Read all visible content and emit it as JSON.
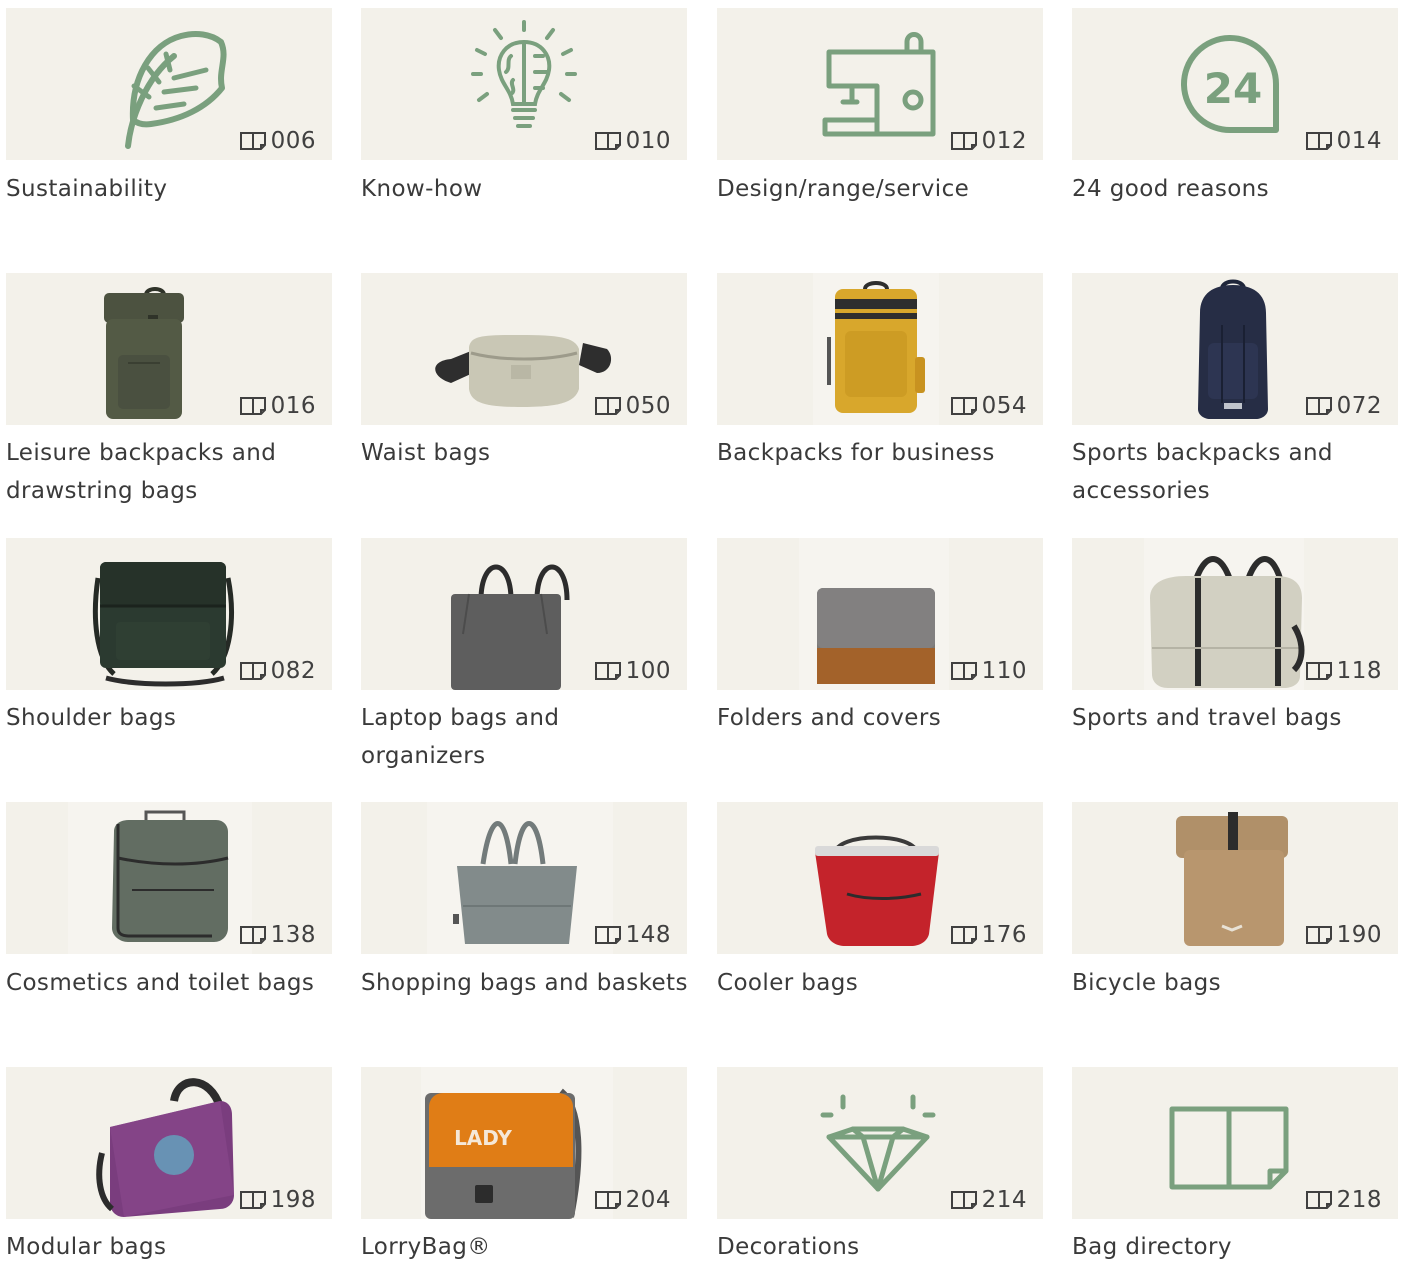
{
  "accent_color": "#7aa07e",
  "tile_color": "#f3f1ea",
  "categories": [
    {
      "label": "Sustainability",
      "page": "006",
      "icon": "leaf-icon"
    },
    {
      "label": "Know-how",
      "page": "010",
      "icon": "lightbulb-brain-icon"
    },
    {
      "label": "Design/range/service",
      "page": "012",
      "icon": "sewing-machine-icon"
    },
    {
      "label": "24 good reasons",
      "page": "014",
      "icon": "badge-24-icon",
      "icon_text": "24"
    },
    {
      "label": "Leisure backpacks and drawstring bags",
      "page": "016",
      "icon": "green-rolltop-backpack-image"
    },
    {
      "label": "Waist bags",
      "page": "050",
      "icon": "beige-waist-bag-image"
    },
    {
      "label": "Backpacks for business",
      "page": "054",
      "icon": "yellow-business-backpack-image"
    },
    {
      "label": "Sports backpacks and accessories",
      "page": "072",
      "icon": "navy-sports-backpack-image"
    },
    {
      "label": "Shoulder bags",
      "page": "082",
      "icon": "dark-green-shoulder-bag-image"
    },
    {
      "label": "Laptop bags and organizers",
      "page": "100",
      "icon": "grey-laptop-bag-image"
    },
    {
      "label": "Folders and covers",
      "page": "110",
      "icon": "grey-cork-folder-image"
    },
    {
      "label": "Sports and travel bags",
      "page": "118",
      "icon": "beige-travel-duffel-image"
    },
    {
      "label": "Cosmetics and toilet bags",
      "page": "138",
      "icon": "green-toiletry-bag-image"
    },
    {
      "label": "Shopping bags and baskets",
      "page": "148",
      "icon": "grey-tote-bag-image"
    },
    {
      "label": "Cooler bags",
      "page": "176",
      "icon": "red-cooler-bag-image"
    },
    {
      "label": "Bicycle bags",
      "page": "190",
      "icon": "tan-bicycle-backpack-image"
    },
    {
      "label": "Modular bags",
      "page": "198",
      "icon": "purple-modular-bag-image"
    },
    {
      "label": "LorryBag®",
      "page": "204",
      "icon": "orange-lorrybag-image",
      "icon_text": "LADY"
    },
    {
      "label": "Decorations",
      "page": "214",
      "icon": "diamond-icon"
    },
    {
      "label": "Bag directory",
      "page": "218",
      "icon": "open-book-icon"
    }
  ]
}
